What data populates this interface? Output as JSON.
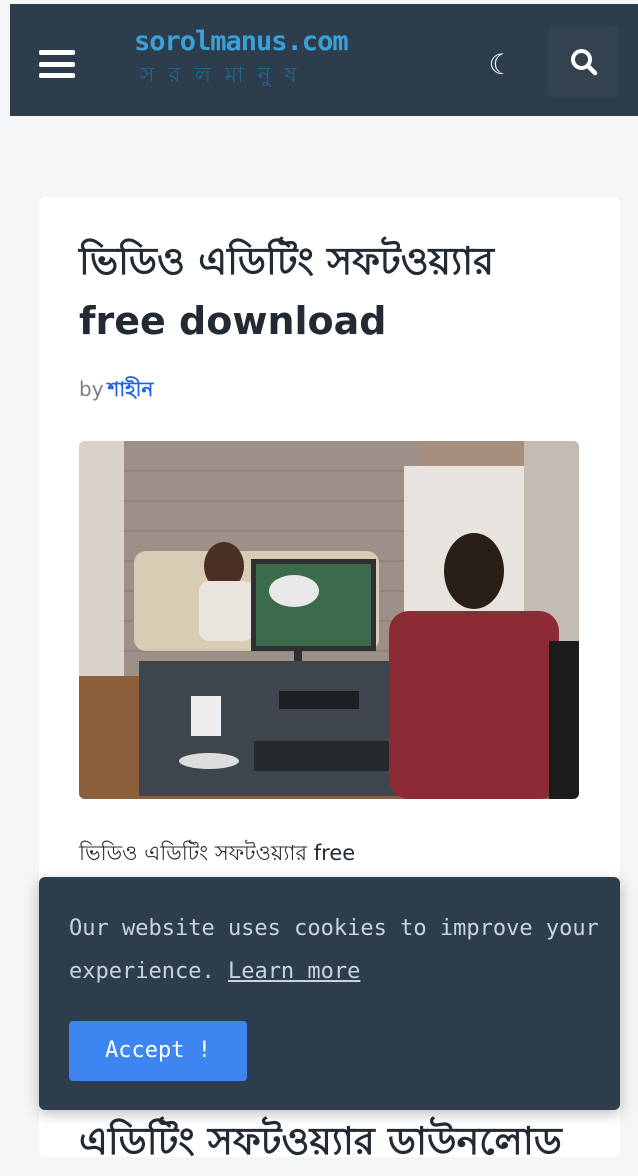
{
  "header": {
    "logo_text": "sorolmanus.com",
    "logo_subtext": "সরলমানুষ",
    "menu_icon": "hamburger-menu-icon",
    "theme_icon": "moon-icon",
    "search_icon": "search-icon",
    "theme_glyph": "☾"
  },
  "post": {
    "title_bn": "ভিডিও এডিটিং সফটওয়্যার",
    "title_en": "free download",
    "by_label": "by",
    "author": "শাহীন",
    "excerpt": "ভিডিও এডিটিং সফটওয়্যার free",
    "next_heading": "এডিটিং সফটওয়্যার ডাউনলোড"
  },
  "cookie_banner": {
    "message": "Our website uses cookies to improve your experience.",
    "learn_more": "Learn more",
    "accept": "Accept !"
  },
  "colors": {
    "header_bg": "#2e3d4c",
    "accent_blue": "#3d85f0",
    "author_link": "#1e66e6",
    "page_bg": "#f3f5f6"
  }
}
